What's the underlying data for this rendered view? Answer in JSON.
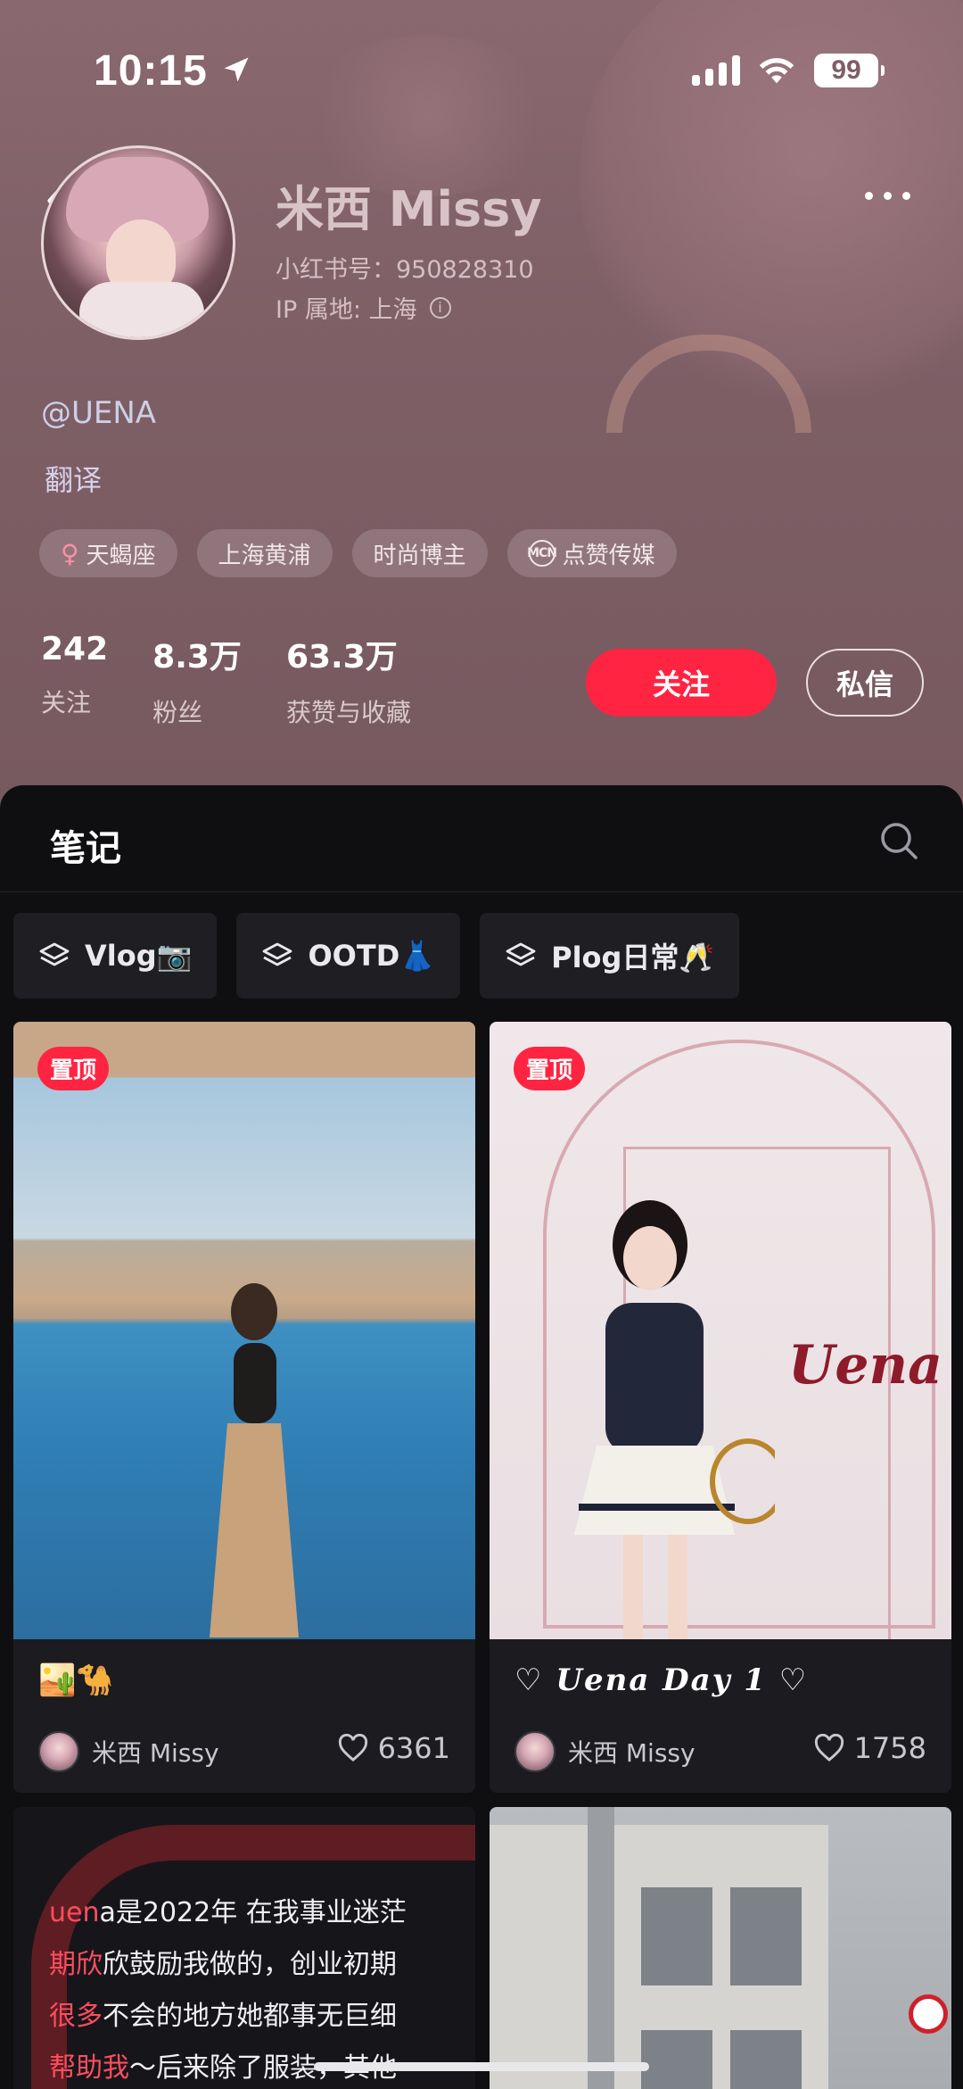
{
  "status_bar": {
    "time": "10:15",
    "battery": "99"
  },
  "profile": {
    "nickname": "米西 Missy",
    "red_id": "小红书号：950828310",
    "ip_location": "IP 属地: 上海",
    "handle": "@UENA",
    "description": "翻译",
    "tags": [
      {
        "icon": "female-icon",
        "label": "天蝎座"
      },
      {
        "icon": "",
        "label": "上海黄浦"
      },
      {
        "icon": "",
        "label": "时尚博主"
      },
      {
        "icon": "mcn-icon",
        "label": "点赞传媒"
      }
    ],
    "stats": [
      {
        "value": "242",
        "label": "关注"
      },
      {
        "value": "8.3万",
        "label": "粉丝"
      },
      {
        "value": "63.3万",
        "label": "获赞与收藏"
      }
    ],
    "follow_label": "关注",
    "message_label": "私信",
    "mcn_icon_text": "MCN"
  },
  "notes": {
    "title": "笔记",
    "collections": [
      {
        "icon": "layers-icon",
        "label": "Vlog📷"
      },
      {
        "icon": "layers-icon",
        "label": "OOTD👗"
      },
      {
        "icon": "layers-icon",
        "label": "Plog日常🥂"
      }
    ],
    "cards": [
      {
        "pin": "置顶",
        "title": "🏜️🐪",
        "author": "米西 Missy",
        "likes": "6361"
      },
      {
        "pin": "置顶",
        "title": "♡ Uena Day 1 ♡",
        "author": "米西 Missy",
        "likes": "1758"
      }
    ],
    "text_card": {
      "lines": [
        [
          "uen",
          "a是2022年 在我事业迷茫"
        ],
        [
          "期欣",
          "欣鼓励我做的，创业初期"
        ],
        [
          "很多",
          "不会的地方她都事无巨细"
        ],
        [
          "帮助我",
          "～后来除了服装，其他"
        ]
      ]
    }
  },
  "colors": {
    "accent": "#ff2442",
    "panel": "#0f0f12",
    "header": "#7e5f66"
  }
}
